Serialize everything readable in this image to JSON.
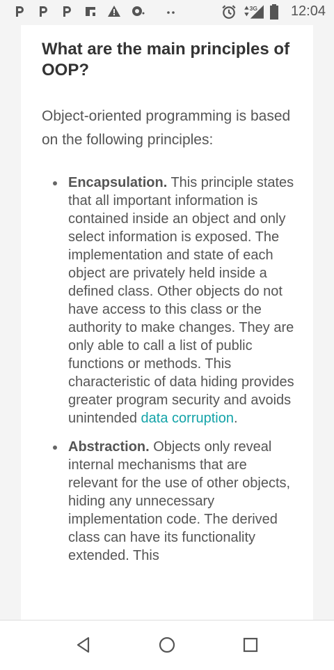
{
  "status_bar": {
    "time": "12:04",
    "network": "3G",
    "notification_icons": [
      "pinterest-icon",
      "pinterest-icon",
      "pinterest-icon",
      "flipboard-icon",
      "warning-icon",
      "chat-icon",
      "more-dots-icon"
    ],
    "system_icons": [
      "alarm-icon",
      "signal-icon",
      "battery-icon"
    ]
  },
  "article": {
    "heading": "What are the main principles of OOP?",
    "intro": "Object-oriented programming is based on the following principles:",
    "principles": [
      {
        "term": "Encapsulation.",
        "text": " This principle states that all important information is contained inside an object and only select information is exposed. The implementation and state of each object are privately held inside a defined class. Other objects do not have access to this class or the authority to make changes. They are only able to call a list of public functions or methods. This characteristic of data hiding provides greater program security and avoids unintended ",
        "link": "data corruption",
        "after_link": "."
      },
      {
        "term": "Abstraction.",
        "text": " Objects only reveal internal mechanisms that are relevant for the use of other objects, hiding any unnecessary implementation code. The derived class can have its functionality extended. This"
      }
    ]
  },
  "nav_bar": {
    "buttons": [
      "back",
      "home",
      "recents"
    ]
  },
  "colors": {
    "link": "#13a3a8",
    "text": "#555555",
    "heading": "#333333",
    "background": "#f4f4f4"
  }
}
